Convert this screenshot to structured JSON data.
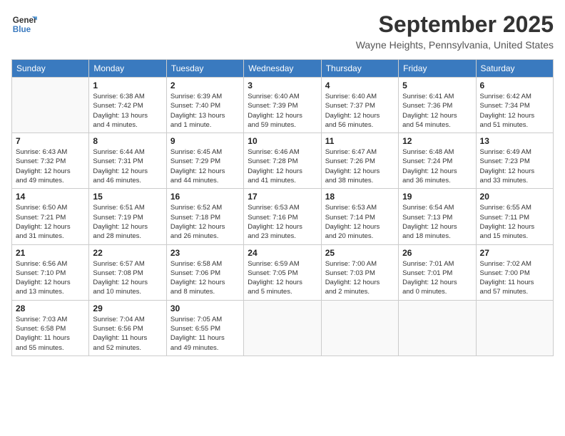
{
  "header": {
    "logo_line1": "General",
    "logo_line2": "Blue",
    "month_title": "September 2025",
    "location": "Wayne Heights, Pennsylvania, United States"
  },
  "weekdays": [
    "Sunday",
    "Monday",
    "Tuesday",
    "Wednesday",
    "Thursday",
    "Friday",
    "Saturday"
  ],
  "weeks": [
    [
      {
        "day": "",
        "info": ""
      },
      {
        "day": "1",
        "info": "Sunrise: 6:38 AM\nSunset: 7:42 PM\nDaylight: 13 hours\nand 4 minutes."
      },
      {
        "day": "2",
        "info": "Sunrise: 6:39 AM\nSunset: 7:40 PM\nDaylight: 13 hours\nand 1 minute."
      },
      {
        "day": "3",
        "info": "Sunrise: 6:40 AM\nSunset: 7:39 PM\nDaylight: 12 hours\nand 59 minutes."
      },
      {
        "day": "4",
        "info": "Sunrise: 6:40 AM\nSunset: 7:37 PM\nDaylight: 12 hours\nand 56 minutes."
      },
      {
        "day": "5",
        "info": "Sunrise: 6:41 AM\nSunset: 7:36 PM\nDaylight: 12 hours\nand 54 minutes."
      },
      {
        "day": "6",
        "info": "Sunrise: 6:42 AM\nSunset: 7:34 PM\nDaylight: 12 hours\nand 51 minutes."
      }
    ],
    [
      {
        "day": "7",
        "info": "Sunrise: 6:43 AM\nSunset: 7:32 PM\nDaylight: 12 hours\nand 49 minutes."
      },
      {
        "day": "8",
        "info": "Sunrise: 6:44 AM\nSunset: 7:31 PM\nDaylight: 12 hours\nand 46 minutes."
      },
      {
        "day": "9",
        "info": "Sunrise: 6:45 AM\nSunset: 7:29 PM\nDaylight: 12 hours\nand 44 minutes."
      },
      {
        "day": "10",
        "info": "Sunrise: 6:46 AM\nSunset: 7:28 PM\nDaylight: 12 hours\nand 41 minutes."
      },
      {
        "day": "11",
        "info": "Sunrise: 6:47 AM\nSunset: 7:26 PM\nDaylight: 12 hours\nand 38 minutes."
      },
      {
        "day": "12",
        "info": "Sunrise: 6:48 AM\nSunset: 7:24 PM\nDaylight: 12 hours\nand 36 minutes."
      },
      {
        "day": "13",
        "info": "Sunrise: 6:49 AM\nSunset: 7:23 PM\nDaylight: 12 hours\nand 33 minutes."
      }
    ],
    [
      {
        "day": "14",
        "info": "Sunrise: 6:50 AM\nSunset: 7:21 PM\nDaylight: 12 hours\nand 31 minutes."
      },
      {
        "day": "15",
        "info": "Sunrise: 6:51 AM\nSunset: 7:19 PM\nDaylight: 12 hours\nand 28 minutes."
      },
      {
        "day": "16",
        "info": "Sunrise: 6:52 AM\nSunset: 7:18 PM\nDaylight: 12 hours\nand 26 minutes."
      },
      {
        "day": "17",
        "info": "Sunrise: 6:53 AM\nSunset: 7:16 PM\nDaylight: 12 hours\nand 23 minutes."
      },
      {
        "day": "18",
        "info": "Sunrise: 6:53 AM\nSunset: 7:14 PM\nDaylight: 12 hours\nand 20 minutes."
      },
      {
        "day": "19",
        "info": "Sunrise: 6:54 AM\nSunset: 7:13 PM\nDaylight: 12 hours\nand 18 minutes."
      },
      {
        "day": "20",
        "info": "Sunrise: 6:55 AM\nSunset: 7:11 PM\nDaylight: 12 hours\nand 15 minutes."
      }
    ],
    [
      {
        "day": "21",
        "info": "Sunrise: 6:56 AM\nSunset: 7:10 PM\nDaylight: 12 hours\nand 13 minutes."
      },
      {
        "day": "22",
        "info": "Sunrise: 6:57 AM\nSunset: 7:08 PM\nDaylight: 12 hours\nand 10 minutes."
      },
      {
        "day": "23",
        "info": "Sunrise: 6:58 AM\nSunset: 7:06 PM\nDaylight: 12 hours\nand 8 minutes."
      },
      {
        "day": "24",
        "info": "Sunrise: 6:59 AM\nSunset: 7:05 PM\nDaylight: 12 hours\nand 5 minutes."
      },
      {
        "day": "25",
        "info": "Sunrise: 7:00 AM\nSunset: 7:03 PM\nDaylight: 12 hours\nand 2 minutes."
      },
      {
        "day": "26",
        "info": "Sunrise: 7:01 AM\nSunset: 7:01 PM\nDaylight: 12 hours\nand 0 minutes."
      },
      {
        "day": "27",
        "info": "Sunrise: 7:02 AM\nSunset: 7:00 PM\nDaylight: 11 hours\nand 57 minutes."
      }
    ],
    [
      {
        "day": "28",
        "info": "Sunrise: 7:03 AM\nSunset: 6:58 PM\nDaylight: 11 hours\nand 55 minutes."
      },
      {
        "day": "29",
        "info": "Sunrise: 7:04 AM\nSunset: 6:56 PM\nDaylight: 11 hours\nand 52 minutes."
      },
      {
        "day": "30",
        "info": "Sunrise: 7:05 AM\nSunset: 6:55 PM\nDaylight: 11 hours\nand 49 minutes."
      },
      {
        "day": "",
        "info": ""
      },
      {
        "day": "",
        "info": ""
      },
      {
        "day": "",
        "info": ""
      },
      {
        "day": "",
        "info": ""
      }
    ]
  ]
}
